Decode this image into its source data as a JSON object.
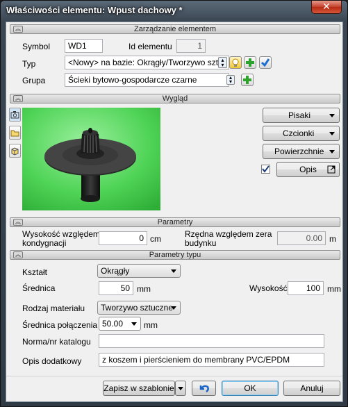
{
  "window": {
    "title": "Właściwości elementu: Wpust dachowy *",
    "close": "✕"
  },
  "sections": {
    "management": "Zarządzanie elementem",
    "appearance": "Wygląd",
    "parameters": "Parametry",
    "type_parameters": "Parametry typu"
  },
  "management": {
    "symbol_label": "Symbol",
    "symbol_value": "WD1",
    "id_label": "Id elementu",
    "id_value": "1",
    "type_label": "Typ",
    "type_value": "<Nowy> na bazie: Okrągły/Tworzywo sztuc",
    "group_label": "Grupa",
    "group_value": "Ścieki bytowo-gospodarcze czarne"
  },
  "appearance": {
    "pens": "Pisaki",
    "fonts": "Czcionki",
    "surfaces": "Powierzchnie",
    "description_btn": "Opis",
    "description_checked": true
  },
  "parameters": {
    "height_label_1": "Wysokość względem",
    "height_label_2": "kondygnacji",
    "height_value": "0",
    "height_unit": "cm",
    "ordinate_label_1": "Rzędna względem zera",
    "ordinate_label_2": "budynku",
    "ordinate_value": "0.00",
    "ordinate_unit": "m"
  },
  "type_params": {
    "shape_label": "Kształt",
    "shape_value": "Okrągły",
    "diameter_label": "Średnica",
    "diameter_value": "50",
    "diameter_unit": "mm",
    "tall_label": "Wysokość",
    "tall_value": "100",
    "tall_unit": "mm",
    "material_label": "Rodzaj materiału",
    "material_value": "Tworzywo sztuczne",
    "conn_label": "Średnica połączenia",
    "conn_value": "50.00",
    "conn_unit": "mm",
    "catalog_label": "Norma/nr katalogu",
    "catalog_value": "",
    "extra_label": "Opis dodatkowy",
    "extra_value": "z koszem i pierścieniem do membrany PVC/EPDM"
  },
  "footer": {
    "save_template": "Zapisz w szablonie",
    "ok": "OK",
    "cancel": "Anuluj"
  },
  "colors": {
    "preview_bg": "#5fd865",
    "accent": "#3c7fd3"
  }
}
